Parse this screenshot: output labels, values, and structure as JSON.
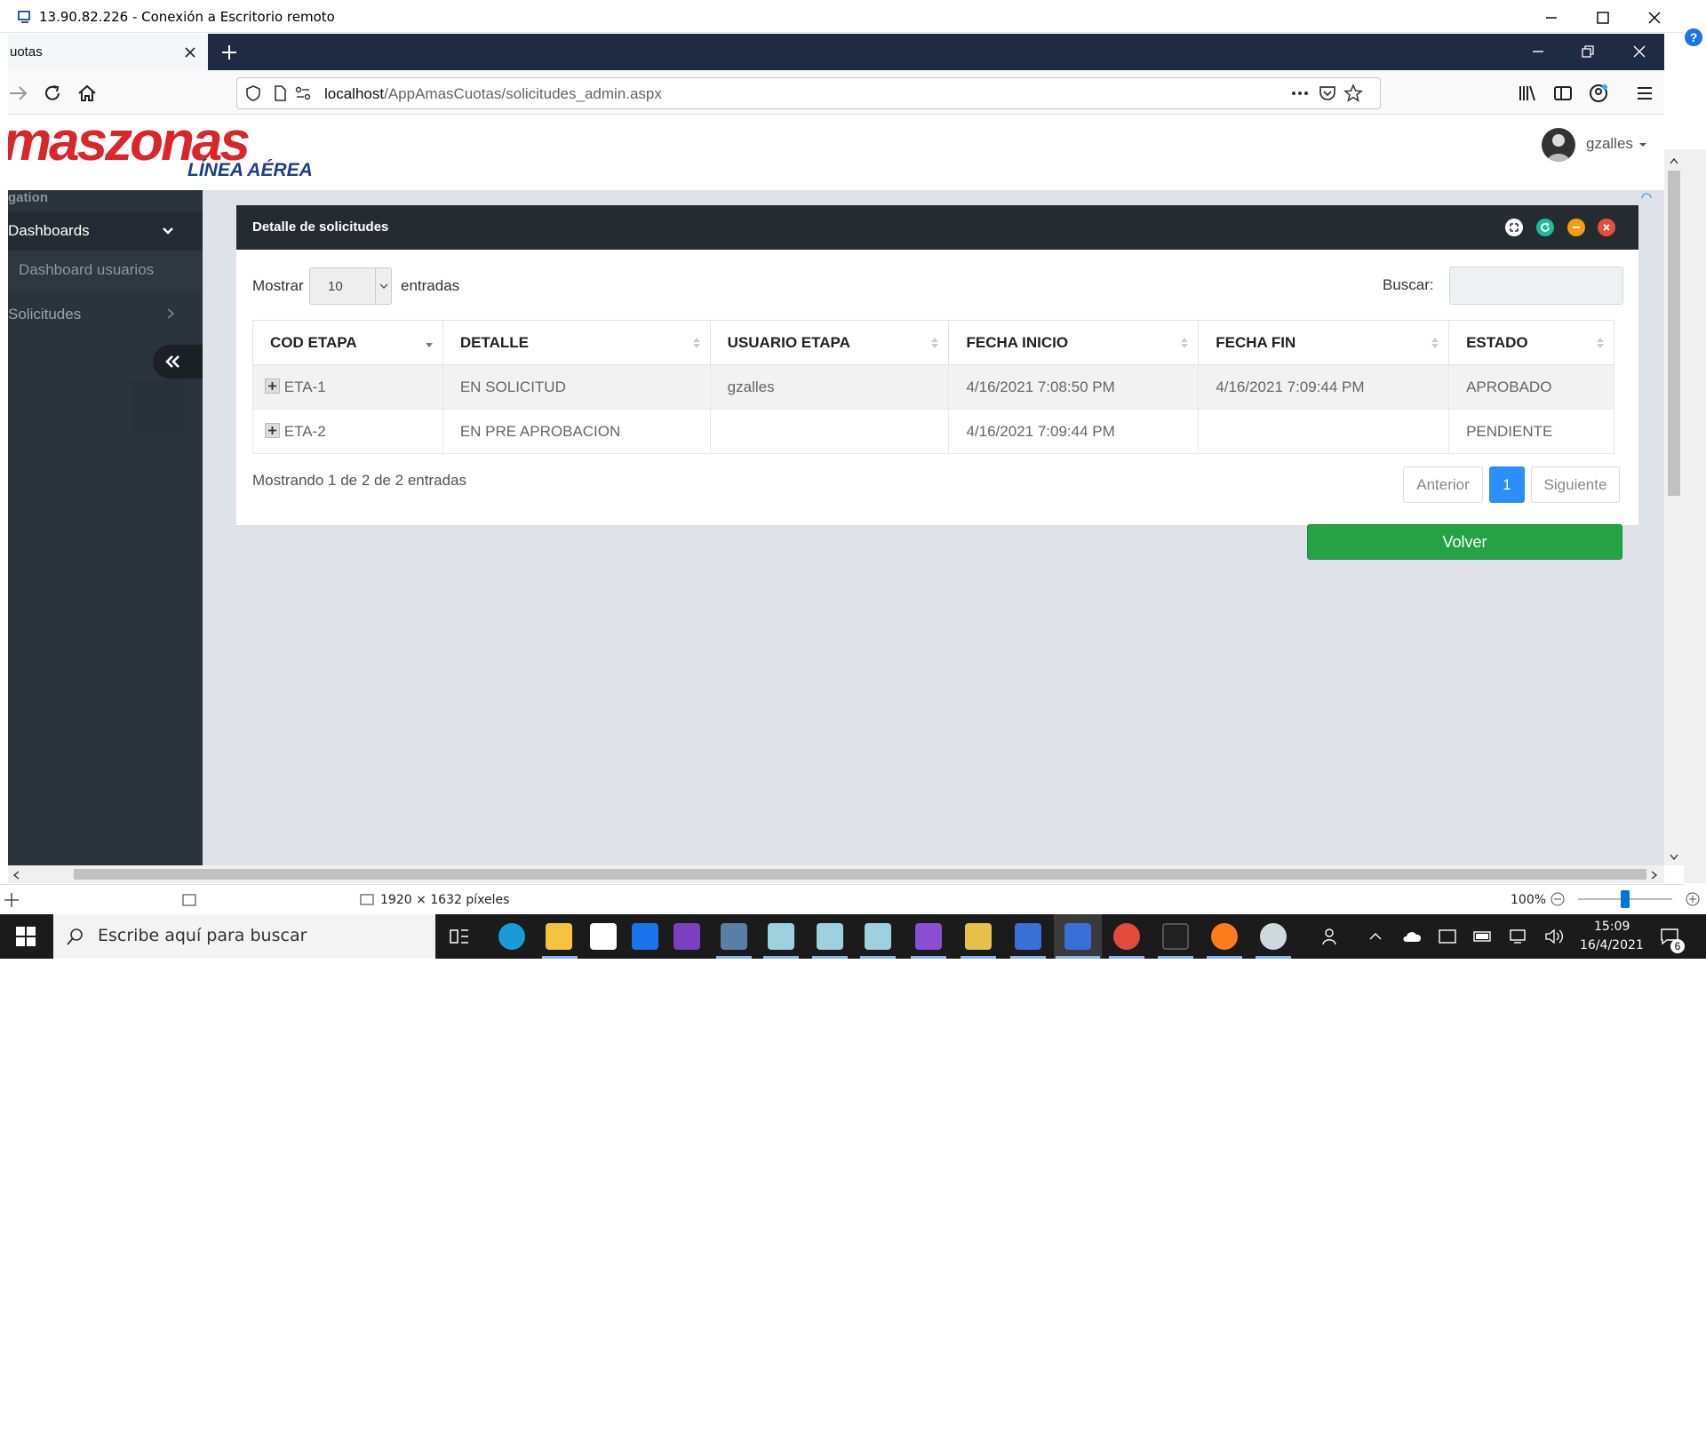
{
  "rdp": {
    "title": "13.90.82.226 - Conexión a Escritorio remoto"
  },
  "browser": {
    "tab_title": "uotas",
    "url_host": "localhost",
    "url_path": "/AppAmasCuotas/solicitudes_admin.aspx"
  },
  "site": {
    "logo_text": "maszonas",
    "logo_subtitle": "LÍNEA AÉREA",
    "user_name": "gzalles"
  },
  "sidebar": {
    "section_label": "gation",
    "items": [
      {
        "label": "Dashboards"
      },
      {
        "label": "Dashboard usuarios"
      },
      {
        "label": "Solicitudes"
      }
    ]
  },
  "panel": {
    "title": "Detalle de solicitudes",
    "show_label": "Mostrar",
    "page_size": "10",
    "entries_label": "entradas",
    "search_label": "Buscar:",
    "search_value": "",
    "columns": [
      "COD ETAPA",
      "DETALLE",
      "USUARIO ETAPA",
      "FECHA INICIO",
      "FECHA FIN",
      "ESTADO"
    ],
    "rows": [
      [
        "ETA-1",
        "EN SOLICITUD",
        "gzalles",
        "4/16/2021 7:08:50 PM",
        "4/16/2021 7:09:44 PM",
        "APROBADO"
      ],
      [
        "ETA-2",
        "EN PRE APROBACION",
        "",
        "4/16/2021 7:09:44 PM",
        "",
        "PENDIENTE"
      ]
    ],
    "info": "Mostrando 1 de 2 de 2 entradas",
    "prev_label": "Anterior",
    "current_page": "1",
    "next_label": "Siguiente",
    "back_button": "Volver"
  },
  "statusbar": {
    "dimensions": "1920 × 1632 píxeles",
    "zoom": "100%"
  },
  "taskbar": {
    "search_placeholder": "Escribe aquí para buscar",
    "time": "15:09",
    "date": "16/4/2021",
    "notification_count": "6"
  },
  "colors": {
    "accent": "#2c8ef8",
    "success": "#25a244",
    "sidebar": "#2b333d",
    "panel_header": "#262b32",
    "tabstrip": "#1f2a44"
  }
}
